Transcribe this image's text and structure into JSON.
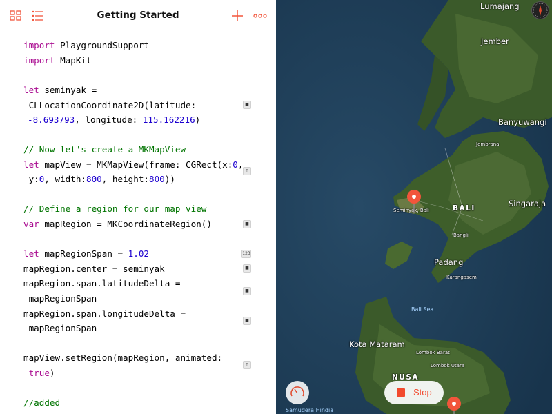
{
  "toolbar": {
    "title": "Getting Started",
    "grid_icon": "grid-icon",
    "list_icon": "list-icon",
    "add_icon": "plus-icon",
    "more_icon": "ellipsis-icon",
    "accent_color": "#f2553b"
  },
  "code": {
    "l1_kw": "import",
    "l1_rest": " PlaygroundSupport",
    "l2_kw": "import",
    "l2_rest": " MapKit",
    "l3_kw": "let",
    "l3_rest": " seminyak =",
    "l4": " CLLocationCoordinate2D(latitude:",
    "l5_num1": "-8.693793",
    "l5_mid": ", longitude: ",
    "l5_num2": "115.162216",
    "l5_end": ")",
    "l6": "// Now let's create a MKMapView",
    "l7_kw": "let",
    "l7_a": " mapView = MKMapView(frame: CGRect(x:",
    "l7_num": "0",
    "l7_end": ",",
    "l8_a": " y:",
    "l8_n1": "0",
    "l8_b": ", width:",
    "l8_n2": "800",
    "l8_c": ", height:",
    "l8_n3": "800",
    "l8_d": "))",
    "l9": "// Define a region for our map view",
    "l10_kw": "var",
    "l10_rest": " mapRegion = MKCoordinateRegion()",
    "l11_kw": "let",
    "l11_rest": " mapRegionSpan = ",
    "l11_num": "1.02",
    "l12": "mapRegion.center = seminyak",
    "l13": "mapRegion.span.latitudeDelta =",
    "l14": " mapRegionSpan",
    "l15": "mapRegion.span.longitudeDelta =",
    "l16": " mapRegionSpan",
    "l17": "mapView.setRegion(mapRegion, animated:",
    "l18_kw": " true",
    "l18_end": ")",
    "l19": "//added"
  },
  "results": {
    "num_chip": "123"
  },
  "map": {
    "labels": {
      "lumajang": "Lumajang",
      "jember": "Jember",
      "banyuwangi": "Banyuwangi",
      "jembrana": "Jembrana",
      "seminyak": "Seminyak, Bali",
      "bali": "BALI",
      "singaraja": "Singaraja",
      "bangli": "Bangli",
      "padang": "Padang",
      "karangasem": "Karangasem",
      "bali_sea": "Bali Sea",
      "kota_mataram": "Kota Mataram",
      "lombok_barat": "Lombok Barat",
      "lombok_utara": "Lombok Utara",
      "nusa": "NUSA",
      "samudera": "Samudera Hindia"
    },
    "stop_label": "Stop",
    "pin_color": "#f2553b"
  }
}
